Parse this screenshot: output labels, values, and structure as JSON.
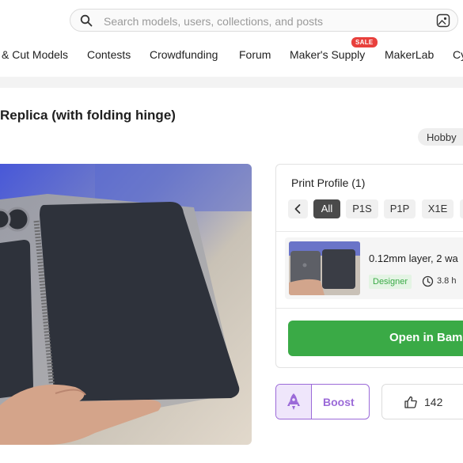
{
  "search": {
    "placeholder": "Search models, users, collections, and posts"
  },
  "nav": {
    "items": [
      "& Cut Models",
      "Contests",
      "Crowdfunding",
      "Forum",
      "Maker's Supply",
      "MakerLab",
      "Cy"
    ],
    "sale_badge": "SALE"
  },
  "model": {
    "title": "Replica (with folding hinge)",
    "tag": "Hobby"
  },
  "print_profile": {
    "title": "Print Profile (1)",
    "filters": [
      "All",
      "P1S",
      "P1P",
      "X1E"
    ],
    "active_filter": "All",
    "profile": {
      "name": "0.12mm layer, 2 wa",
      "badge": "Designer",
      "time": "3.8 h"
    },
    "open_button": "Open in Bam"
  },
  "actions": {
    "boost_label": "Boost",
    "like_count": "142"
  },
  "icons": [
    "search-icon",
    "image-search-icon",
    "chevron-left-icon",
    "clock-icon",
    "rocket-icon",
    "thumbs-up-icon"
  ],
  "colors": {
    "accent_green": "#3aaa46",
    "boost_purple": "#9b6ad8",
    "sale_red": "#e8403c"
  }
}
